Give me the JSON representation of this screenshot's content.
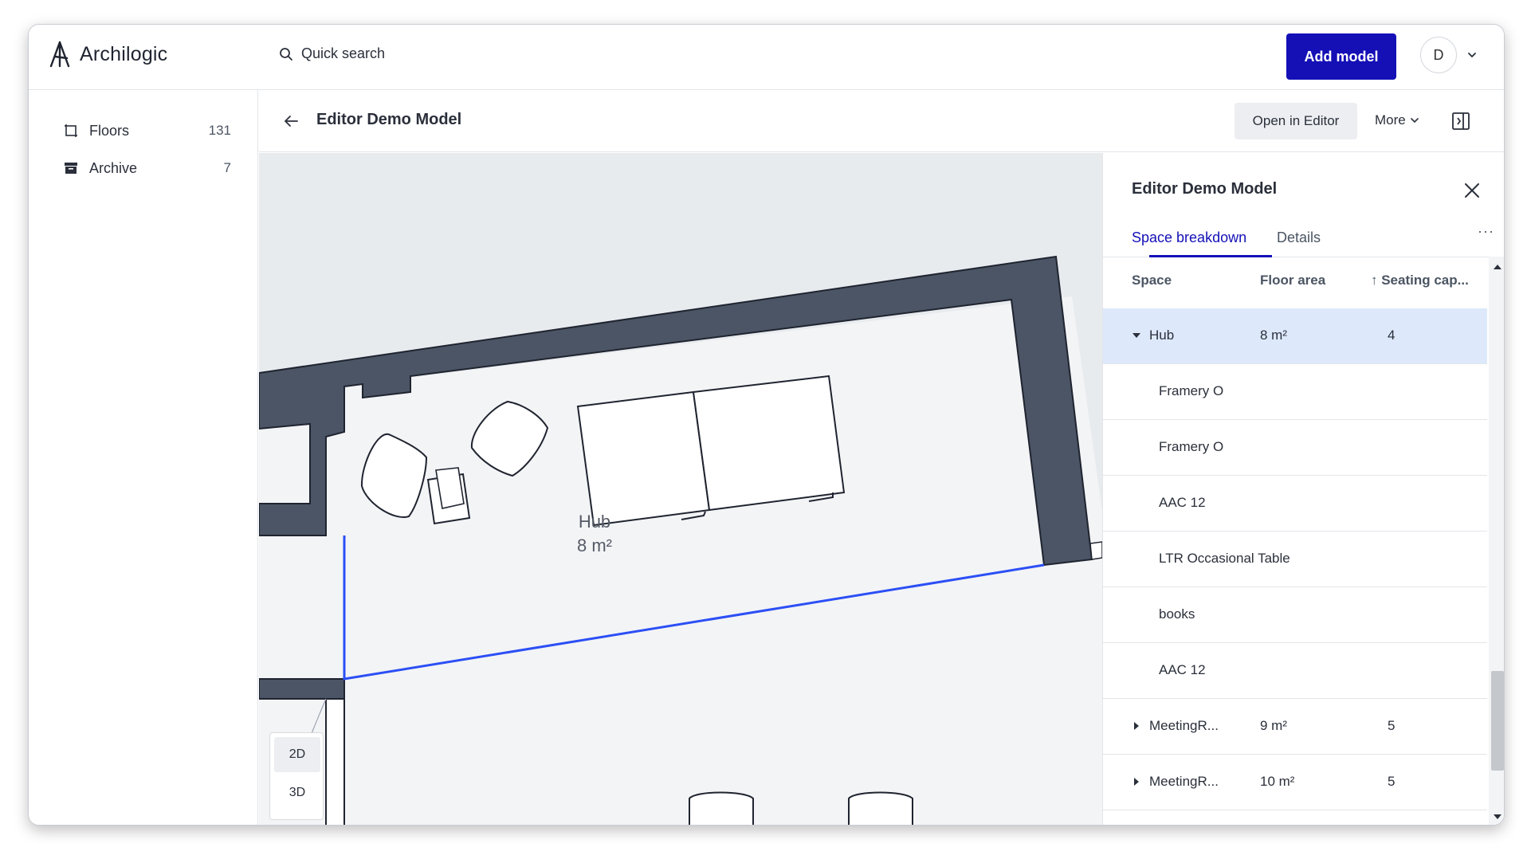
{
  "app": {
    "name": "Archilogic",
    "logo_icon": "archilogic-logo-icon",
    "search_placeholder": "Quick search",
    "add_model_label": "Add model",
    "avatar_initial": "D",
    "accent_color": "#1410b6"
  },
  "sidebar": {
    "items": [
      {
        "label": "Floors",
        "count": "131",
        "icon": "floor-plan-icon"
      },
      {
        "label": "Archive",
        "count": "7",
        "icon": "archive-box-icon"
      }
    ]
  },
  "header": {
    "title": "Editor Demo Model",
    "open_editor_label": "Open in Editor",
    "more_label": "More"
  },
  "canvas": {
    "space_label": "Hub",
    "space_area": "8 m²",
    "view_2d": "2D",
    "view_3d": "3D",
    "active_view": "2D"
  },
  "panel": {
    "title": "Editor Demo Model",
    "tabs": [
      "Space breakdown",
      "Details"
    ],
    "active_tab": "Space breakdown",
    "more": "···",
    "columns": {
      "space": "Space",
      "area": "Floor area",
      "seating": "↑ Seating cap..."
    },
    "rows": [
      {
        "name": "Hub",
        "area": "8 m²",
        "seating": "4",
        "expandable": true,
        "expanded": true,
        "selected": true,
        "level": 0
      },
      {
        "name": "Framery O",
        "area": "",
        "seating": "",
        "expandable": false,
        "level": 1
      },
      {
        "name": "Framery O",
        "area": "",
        "seating": "",
        "expandable": false,
        "level": 1
      },
      {
        "name": "AAC 12",
        "area": "",
        "seating": "",
        "expandable": false,
        "level": 1
      },
      {
        "name": "LTR Occasional Table",
        "area": "",
        "seating": "",
        "expandable": false,
        "level": 1
      },
      {
        "name": "books",
        "area": "",
        "seating": "",
        "expandable": false,
        "level": 1
      },
      {
        "name": "AAC 12",
        "area": "",
        "seating": "",
        "expandable": false,
        "level": 1
      },
      {
        "name": "MeetingR...",
        "area": "9 m²",
        "seating": "5",
        "expandable": true,
        "expanded": false,
        "level": 0
      },
      {
        "name": "MeetingR...",
        "area": "10 m²",
        "seating": "5",
        "expandable": true,
        "expanded": false,
        "level": 0
      }
    ]
  }
}
